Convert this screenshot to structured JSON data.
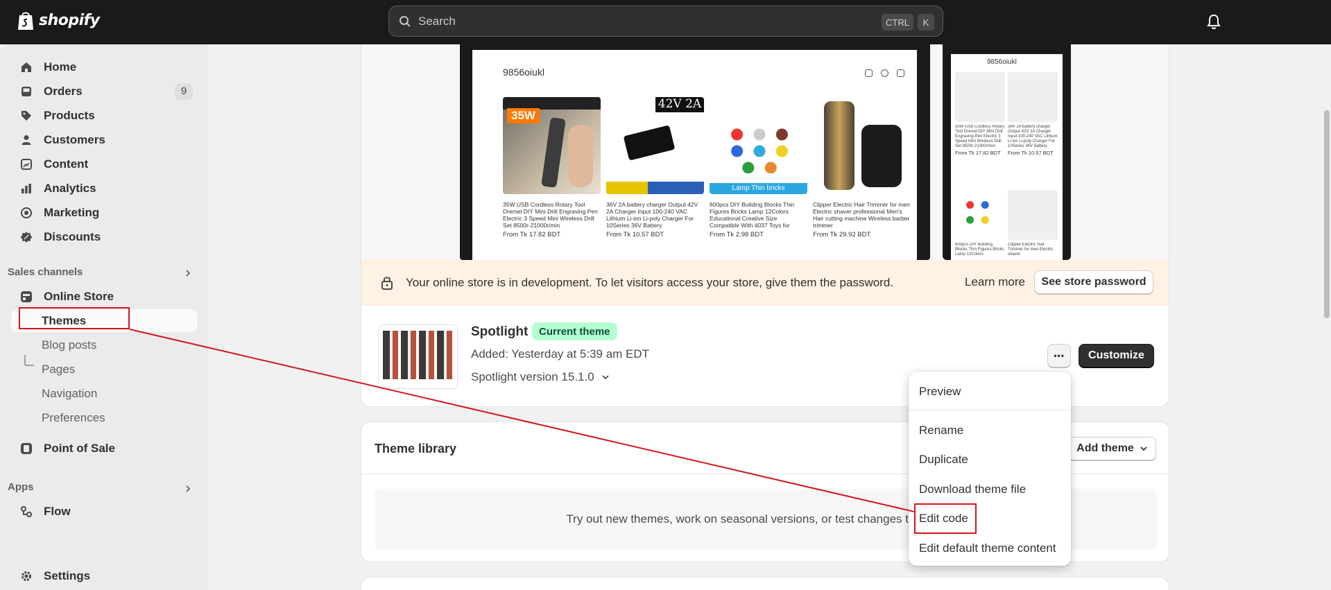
{
  "topbar": {
    "brand": "shopify",
    "search_placeholder": "Search",
    "shortcut_ctrl": "CTRL",
    "shortcut_k": "K"
  },
  "sidebar": {
    "items": [
      {
        "label": "Home",
        "icon": "home-icon"
      },
      {
        "label": "Orders",
        "icon": "orders-icon",
        "badge": "9"
      },
      {
        "label": "Products",
        "icon": "tag-icon"
      },
      {
        "label": "Customers",
        "icon": "person-icon"
      },
      {
        "label": "Content",
        "icon": "content-icon"
      },
      {
        "label": "Analytics",
        "icon": "chart-icon"
      },
      {
        "label": "Marketing",
        "icon": "target-icon"
      },
      {
        "label": "Discounts",
        "icon": "discount-icon"
      }
    ],
    "sales_channels_label": "Sales channels",
    "online_store": "Online Store",
    "sub_items": [
      "Themes",
      "Blog posts",
      "Pages",
      "Navigation",
      "Preferences"
    ],
    "point_of_sale": "Point of Sale",
    "apps_label": "Apps",
    "flow": "Flow",
    "settings": "Settings"
  },
  "preview": {
    "store_name": "9856oiukl",
    "products": [
      {
        "title": "35W USB Cordless Rotary Tool Dremel DIY Mini Drill Engraving Pen Electric 3 Speed Mini Wireless Drill Set 8500r-21000r/min",
        "price": "From Tk 17.82 BDT",
        "badge": "35W"
      },
      {
        "title": "36V 2A battery charger Output 42V 2A Charger Input 100-240 VAC Lithium Li-ion Li-poly Charger For 10Series 36V Battery",
        "price": "From Tk 10.57 BDT",
        "badge": "42V 2A"
      },
      {
        "title": "600pcs DIY Building Blocks Thin Figures Bricks Lamp 12Colors Educational Creative Size Compatible With 4037 Toys for Children",
        "price": "From Tk 2.98 BDT",
        "badge": "Lamp Thin bricks"
      },
      {
        "title": "Clipper Electric Hair Trimmer for men Electric shaver professional Men's Hair cutting machine Wireless barber trimmer",
        "price": "From Tk 29.92 BDT"
      }
    ],
    "phone_products": [
      {
        "title": "35W USB Cordless Rotary Tool Dremel DIY Mini Drill Engraving Pen Electric 3 Speed Mini Wireless Drill Set 8500r-21000r/min",
        "price": "From Tk 17.82 BDT"
      },
      {
        "title": "36V 2A battery charger Output 42V 2A Charger Input 100-240 VAC Lithium Li-ion Li-poly Charger For 10Series 36V Battery",
        "price": "From Tk 10.57 BDT"
      },
      {
        "title": "600pcs DIY Building Blocks Thin Figures Bricks Lamp 12Colors",
        "price": ""
      },
      {
        "title": "Clipper Electric Hair Trimmer for men Electric shaver",
        "price": ""
      }
    ]
  },
  "banner": {
    "message": "Your online store is in development. To let visitors access your store, give them the password.",
    "learn_more": "Learn more",
    "see_password": "See store password"
  },
  "current_theme": {
    "name": "Spotlight",
    "status": "Current theme",
    "added": "Added: Yesterday at 5:39 am EDT",
    "version": "Spotlight version 15.1.0",
    "more_label": "•••",
    "customize": "Customize"
  },
  "library": {
    "title": "Theme library",
    "add_theme": "Add theme",
    "empty_text": "Try out new themes, work on seasonal versions, or test changes to you"
  },
  "menu": {
    "items": [
      "Preview",
      "Rename",
      "Duplicate",
      "Download theme file",
      "Edit code",
      "Edit default theme content"
    ]
  },
  "colors": {
    "topbar": "#1a1a1a",
    "annotation": "#d0171b",
    "current_theme_pill": "#b4fed2",
    "banner": "#fff1e3"
  }
}
